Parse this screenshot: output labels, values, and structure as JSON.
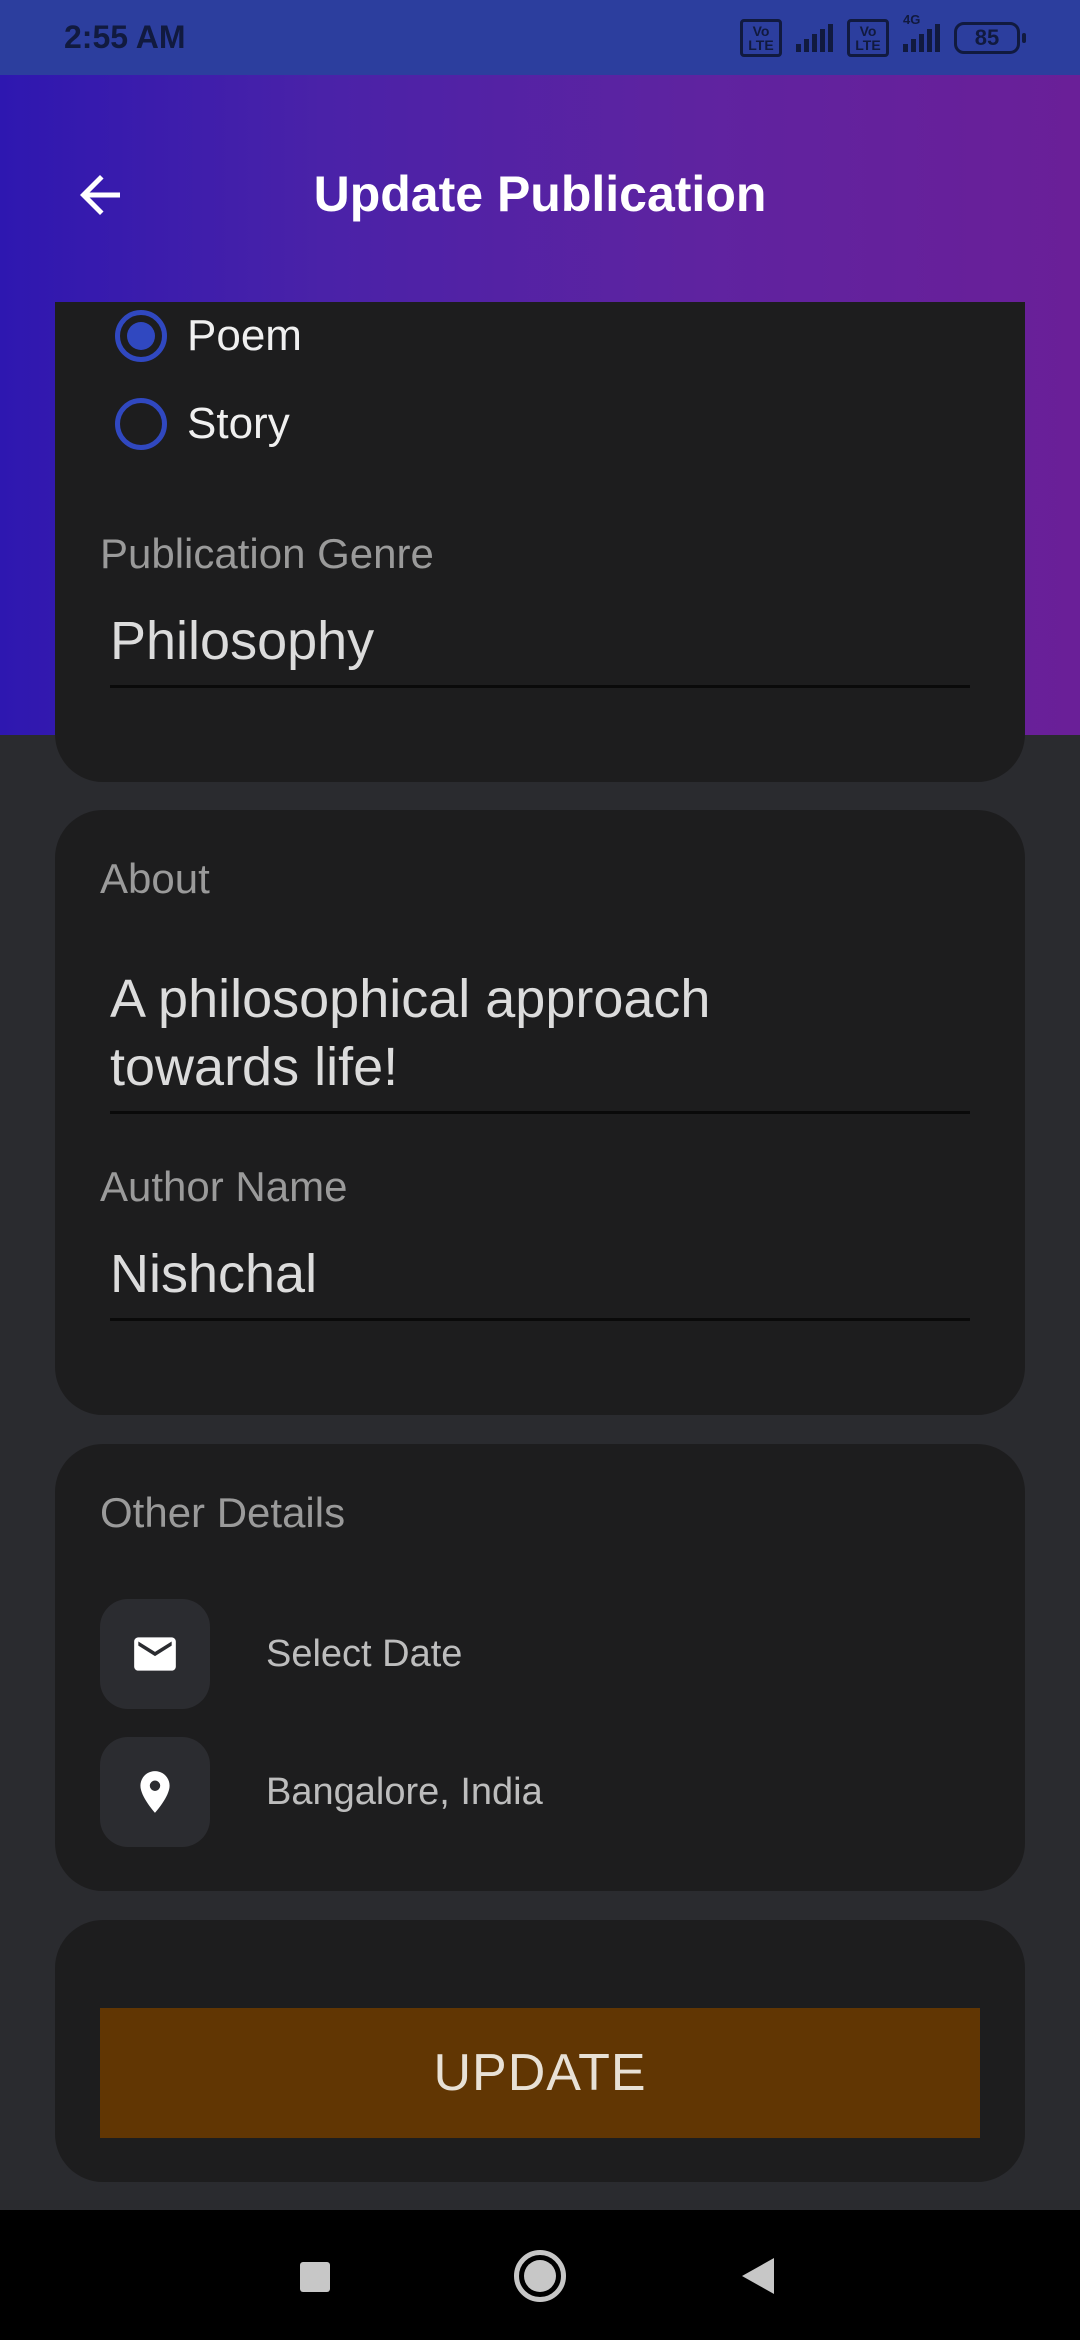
{
  "status_bar": {
    "time": "2:55 AM",
    "sim1": "Vo LTE",
    "sim2": "Vo LTE",
    "network": "4G",
    "battery": "85"
  },
  "header": {
    "title": "Update Publication"
  },
  "publication_type": {
    "options": [
      {
        "label": "Poem",
        "selected": true
      },
      {
        "label": "Story",
        "selected": false
      }
    ]
  },
  "genre": {
    "label": "Publication Genre",
    "value": "Philosophy"
  },
  "about": {
    "label": "About",
    "value": "A philosophical approach towards life!",
    "author_label": "Author Name",
    "author_value": "Nishchal"
  },
  "other_details": {
    "label": "Other Details",
    "date_icon": "envelope-icon",
    "date_text": "Select Date",
    "location_icon": "location-pin-icon",
    "location_text": "Bangalore, India"
  },
  "update_button": {
    "label": "UPDATE"
  },
  "colors": {
    "accent": "#3048c0",
    "button": "#613603",
    "card": "#1d1d1e",
    "background": "#2a2b2f"
  }
}
